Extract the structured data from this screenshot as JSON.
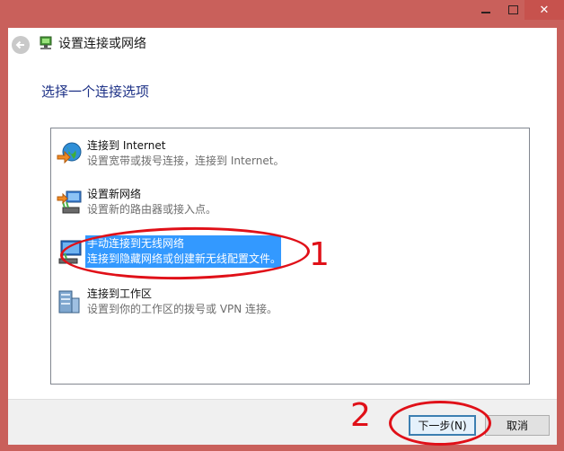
{
  "window": {
    "title": "设置连接或网络",
    "close_glyph": "✕"
  },
  "instruction": "选择一个连接选项",
  "options": [
    {
      "title": "连接到 Internet",
      "desc": "设置宽带或拨号连接，连接到 Internet。",
      "icon": "internet-globe-icon",
      "selected": false
    },
    {
      "title": "设置新网络",
      "desc": "设置新的路由器或接入点。",
      "icon": "network-setup-icon",
      "selected": false
    },
    {
      "title": "手动连接到无线网络",
      "desc": "连接到隐藏网络或创建新无线配置文件。",
      "icon": "wireless-icon",
      "selected": true
    },
    {
      "title": "连接到工作区",
      "desc": "设置到你的工作区的拨号或 VPN 连接。",
      "icon": "workplace-icon",
      "selected": false
    }
  ],
  "buttons": {
    "next": "下一步(N)",
    "cancel": "取消"
  },
  "annotations": {
    "label_1": "1",
    "label_2": "2",
    "color": "#e01018"
  },
  "colors": {
    "frame": "#c9605b",
    "selection": "#3399ff",
    "instruction": "#1e3287"
  }
}
